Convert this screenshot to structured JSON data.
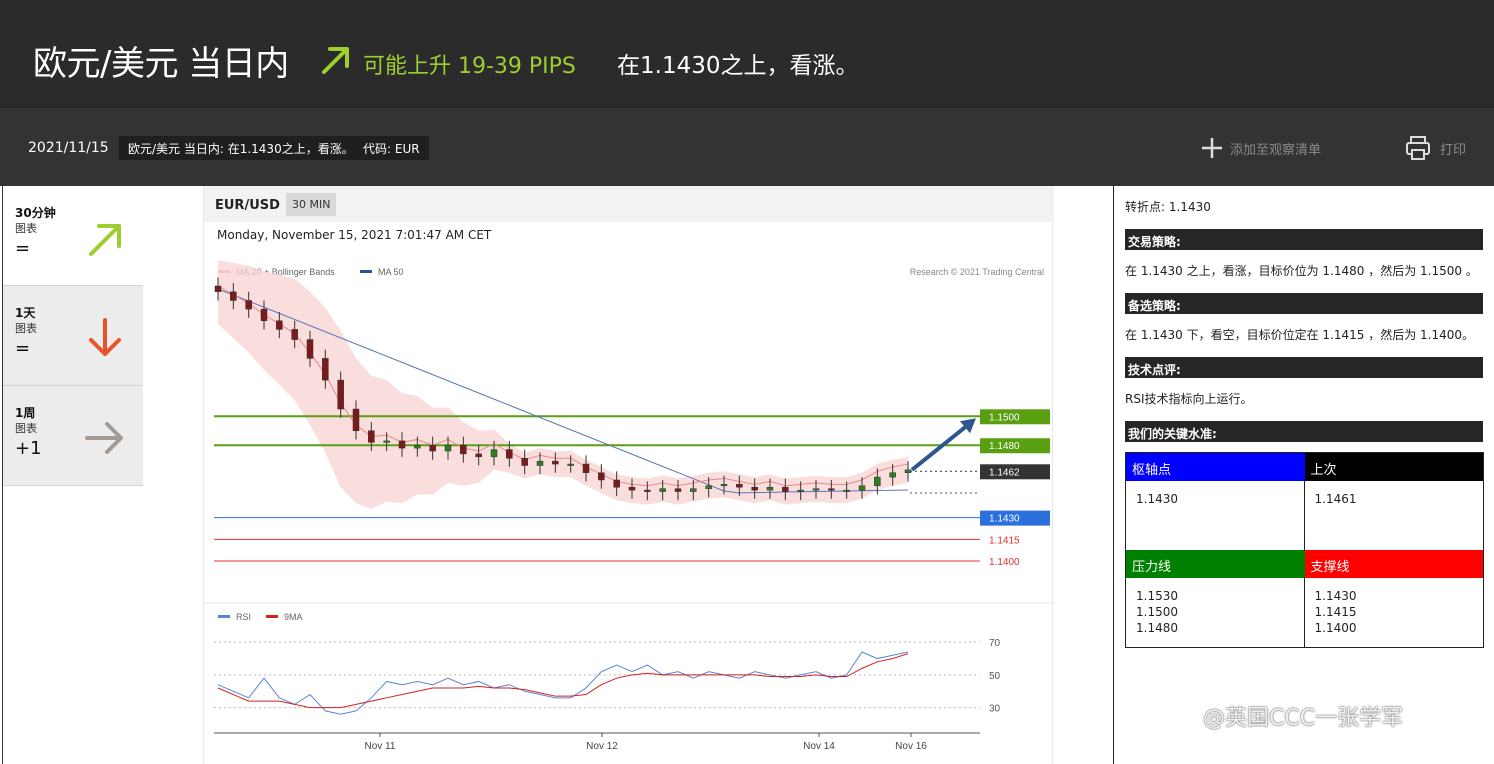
{
  "header": {
    "title": "欧元/美元 当日内",
    "target": "可能上升 19-39 PIPS",
    "description": "在1.1430之上，看涨。",
    "accent_color": "#9ccf2e"
  },
  "subbar": {
    "date": "2021/11/15",
    "summary_tag": "欧元/美元 当日内: 在1.1430之上，看涨。",
    "code_tag": "代码: EUR",
    "watchlist_label": "添加至观察清单",
    "print_label": "打印"
  },
  "timeframes": [
    {
      "name": "30分钟",
      "sub": "图表",
      "score": "=",
      "direction": "up",
      "icon": "arrow-up-right-icon",
      "color": "#9ccf2e"
    },
    {
      "name": "1天",
      "sub": "图表",
      "score": "=",
      "direction": "down",
      "icon": "arrow-down-icon",
      "color": "#e8542a"
    },
    {
      "name": "1周",
      "sub": "图表",
      "score": "+1",
      "direction": "right",
      "icon": "arrow-right-icon",
      "color": "#a39b93"
    }
  ],
  "chart": {
    "symbol": "EUR/USD",
    "timeframe": "30 MIN",
    "datetime": "Monday, November 15, 2021 7:01:47 AM CET",
    "legend_ma20": "MA 20 + Bollinger Bands",
    "legend_ma50": "MA 50",
    "copyright": "Research © 2021 Trading Central",
    "rsi_legend": "RSI",
    "rsi_ma_legend": "9MA",
    "x_ticks": [
      "Nov 11",
      "Nov 12",
      "Nov 14",
      "Nov 16"
    ],
    "rsi_ticks": [
      "70",
      "50",
      "30"
    ]
  },
  "chart_data": {
    "type": "line",
    "price_levels": [
      {
        "label": "1.1500",
        "value": 1.15,
        "kind": "resistance",
        "color": "#5a9e12"
      },
      {
        "label": "1.1480",
        "value": 1.148,
        "kind": "resistance",
        "color": "#5a9e12"
      },
      {
        "label": "1.1462",
        "value": 1.1462,
        "kind": "last",
        "color": "#333333"
      },
      {
        "label": "1.1430",
        "value": 1.143,
        "kind": "pivot",
        "color": "#2a6fdb"
      },
      {
        "label": "1.1415",
        "value": 1.1415,
        "kind": "support",
        "color": "#e03030"
      },
      {
        "label": "1.1400",
        "value": 1.14,
        "kind": "support",
        "color": "#e03030"
      }
    ],
    "price_series": [
      1.1586,
      1.158,
      1.1574,
      1.1566,
      1.156,
      1.1553,
      1.154,
      1.1525,
      1.1505,
      1.149,
      1.1482,
      1.1483,
      1.1478,
      1.148,
      1.1476,
      1.148,
      1.1474,
      1.1472,
      1.1477,
      1.1471,
      1.1466,
      1.1469,
      1.1467,
      1.1467,
      1.1461,
      1.1456,
      1.1451,
      1.1449,
      1.1448,
      1.145,
      1.1448,
      1.145,
      1.1452,
      1.1453,
      1.1451,
      1.1449,
      1.1451,
      1.1448,
      1.1449,
      1.145,
      1.1449,
      1.1449,
      1.1452,
      1.1458,
      1.1461,
      1.1463
    ],
    "rsi_series": [
      44,
      40,
      36,
      48,
      36,
      32,
      38,
      28,
      26,
      28,
      36,
      46,
      44,
      46,
      44,
      48,
      44,
      46,
      42,
      44,
      40,
      38,
      36,
      36,
      42,
      52,
      56,
      52,
      56,
      50,
      52,
      48,
      52,
      50,
      48,
      52,
      50,
      48,
      50,
      52,
      48,
      50,
      64,
      60,
      62,
      64
    ],
    "rsi_ma_series": [
      42,
      38,
      34,
      34,
      34,
      32,
      30,
      30,
      30,
      32,
      34,
      36,
      38,
      40,
      42,
      42,
      42,
      43,
      42,
      42,
      41,
      39,
      37,
      37,
      38,
      44,
      48,
      50,
      51,
      50,
      50,
      50,
      50,
      50,
      50,
      50,
      49,
      49,
      49,
      50,
      49,
      49,
      54,
      58,
      60,
      63
    ],
    "ylim": [
      1.138,
      1.159
    ],
    "rsi_ylim": [
      20,
      75
    ]
  },
  "rightpanel": {
    "pivot_text": "转折点: 1.1430",
    "strategy_title": "交易策略:",
    "strategy_text": "在 1.1430 之上，看涨，目标价位为 1.1480 ，然后为 1.1500 。",
    "alt_title": "备选策略:",
    "alt_text": "在 1.1430 下，看空，目标价位定在 1.1415 ，然后为 1.1400。",
    "comment_title": "技术点评:",
    "comment_text": "RSI技术指标向上运行。",
    "levels_title": "我们的关键水准:",
    "pivot_head": "枢轴点",
    "pivot_value": "1.1430",
    "last_head": "上次",
    "last_value": "1.1461",
    "resistance_head": "压力线",
    "resistance_values": [
      "1.1530",
      "1.1500",
      "1.1480"
    ],
    "support_head": "支撑线",
    "support_values": [
      "1.1430",
      "1.1415",
      "1.1400"
    ]
  },
  "watermark": "@英国CCC一张学军"
}
